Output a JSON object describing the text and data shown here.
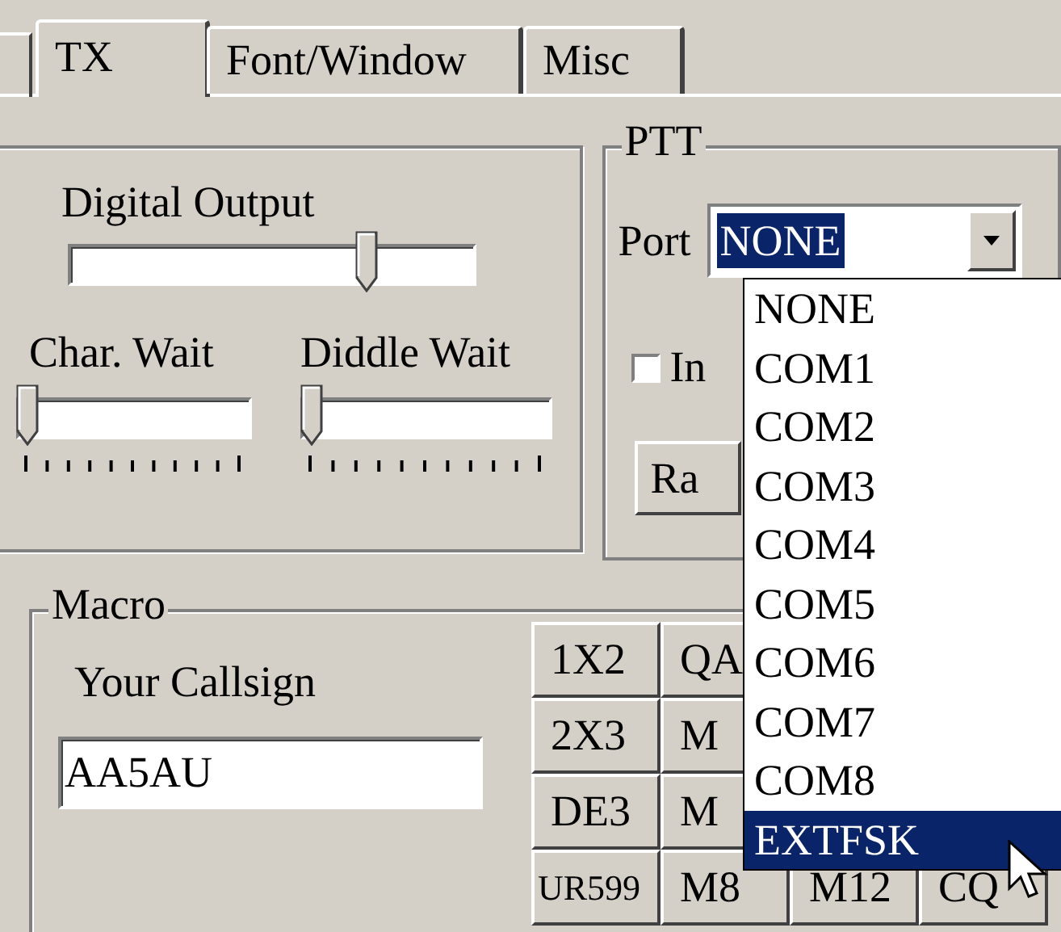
{
  "tabs": [
    {
      "label": "TX",
      "selected": true
    },
    {
      "label": "Font/Window",
      "selected": false
    },
    {
      "label": "Misc",
      "selected": false
    }
  ],
  "output": {
    "sliders": [
      {
        "label": "Digital Output",
        "level": 0.75,
        "ticks": false
      },
      {
        "label": "Char. Wait",
        "level": 0,
        "ticks": true
      },
      {
        "label": "Diddle Wait",
        "level": 0,
        "ticks": true
      }
    ]
  },
  "ptt": {
    "title": "PTT",
    "port_label": "Port",
    "port_value": "NONE",
    "invert": {
      "label": "In",
      "checked": false
    },
    "button": "Ra",
    "port_list": [
      {
        "label": "NONE",
        "selected": false
      },
      {
        "label": "COM1",
        "selected": false
      },
      {
        "label": "COM2",
        "selected": false
      },
      {
        "label": "COM3",
        "selected": false
      },
      {
        "label": "COM4",
        "selected": false
      },
      {
        "label": "COM5",
        "selected": false
      },
      {
        "label": "COM6",
        "selected": false
      },
      {
        "label": "COM7",
        "selected": false
      },
      {
        "label": "COM8",
        "selected": false
      },
      {
        "label": "EXTFSK",
        "selected": true
      }
    ]
  },
  "macro": {
    "title": "Macro",
    "callsign_label": "Your Callsign",
    "callsign_value": "AA5AU",
    "buttons": [
      [
        "1X2",
        "QA"
      ],
      [
        "2X3",
        "M"
      ],
      [
        "DE3",
        "M"
      ],
      [
        "UR599",
        "M8",
        "M12",
        "CQ"
      ]
    ]
  }
}
